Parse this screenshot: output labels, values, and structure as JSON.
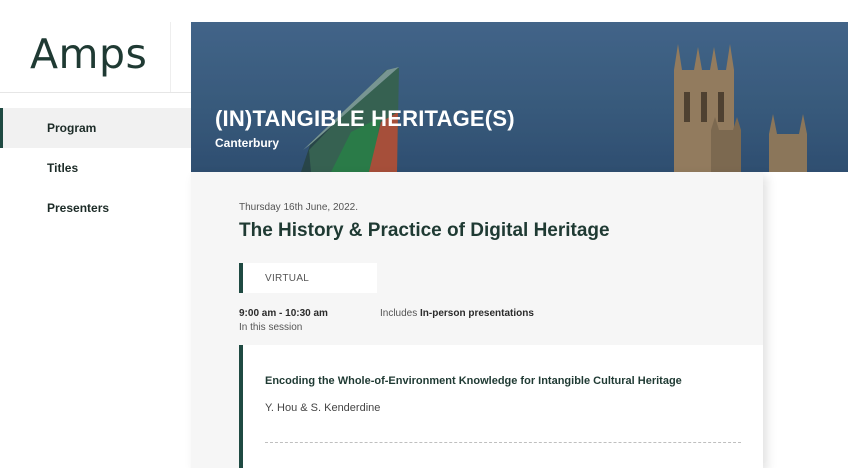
{
  "logo": {
    "text": "Amps"
  },
  "sidebar": {
    "items": [
      {
        "label": "Program",
        "active": true
      },
      {
        "label": "Titles",
        "active": false
      },
      {
        "label": "Presenters",
        "active": false
      }
    ]
  },
  "banner": {
    "title": "(IN)TANGIBLE HERITAGE(S)",
    "subtitle": "Canterbury"
  },
  "session": {
    "date": "Thursday 16th June, 2022.",
    "title": "The History & Practice of Digital Heritage",
    "mode_badge": "VIRTUAL",
    "time": "9:00 am - 10:30 am",
    "in_session_label": "In this session",
    "includes_prefix": "Includes",
    "includes_value": "In-person presentations"
  },
  "papers": [
    {
      "title": "Encoding the Whole-of-Environment Knowledge for Intangible Cultural Heritage",
      "authors": "Y. Hou & S. Kenderdine"
    }
  ],
  "colors": {
    "accent": "#1f4a42",
    "title": "#1f3a33",
    "card_bg": "#f6f6f6",
    "banner_sky": "#3e6286"
  }
}
